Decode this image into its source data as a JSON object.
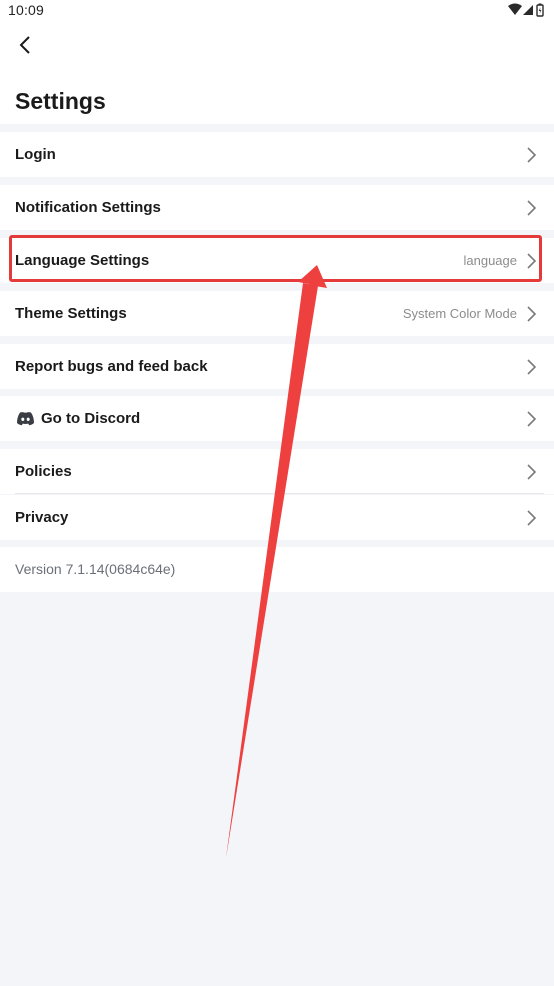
{
  "status_bar": {
    "time": "10:09"
  },
  "header": {
    "title": "Settings"
  },
  "menu": [
    {
      "label": "Login",
      "value": ""
    },
    {
      "label": "Notification Settings",
      "value": ""
    },
    {
      "label": "Language Settings",
      "value": "language"
    },
    {
      "label": "Theme Settings",
      "value": "System Color Mode"
    },
    {
      "label": "Report bugs and feed back",
      "value": ""
    },
    {
      "label": "Go to Discord",
      "value": "",
      "icon": "discord-icon"
    },
    {
      "label": "Policies",
      "value": ""
    },
    {
      "label": "Privacy",
      "value": ""
    }
  ],
  "version": "Version 7.1.14(0684c64e)",
  "colors": {
    "highlight": "#e53a3a",
    "background": "#f4f5f9"
  }
}
